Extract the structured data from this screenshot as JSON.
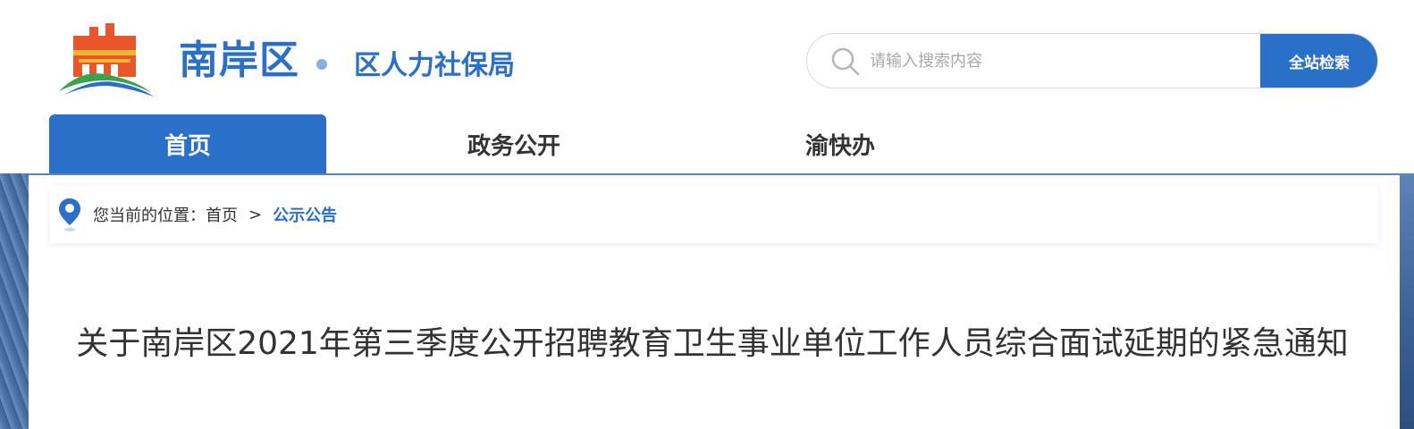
{
  "header": {
    "district_name": "南岸区",
    "department_name": "区人力社保局"
  },
  "search": {
    "placeholder": "请输入搜索内容",
    "button_label": "全站检索"
  },
  "nav": {
    "items": [
      {
        "label": "首页",
        "active": true
      },
      {
        "label": "政务公开",
        "active": false
      },
      {
        "label": "渝快办",
        "active": false
      }
    ]
  },
  "breadcrumb": {
    "prefix": "您当前的位置：",
    "home": "首页",
    "separator": ">",
    "current": "公示公告"
  },
  "article": {
    "title": "关于南岸区2021年第三季度公开招聘教育卫生事业单位工作人员综合面试延期的紧急通知"
  },
  "colors": {
    "brand_blue": "#2a6fc9",
    "logo_orange": "#e8562a",
    "logo_yellow": "#f3b332"
  }
}
